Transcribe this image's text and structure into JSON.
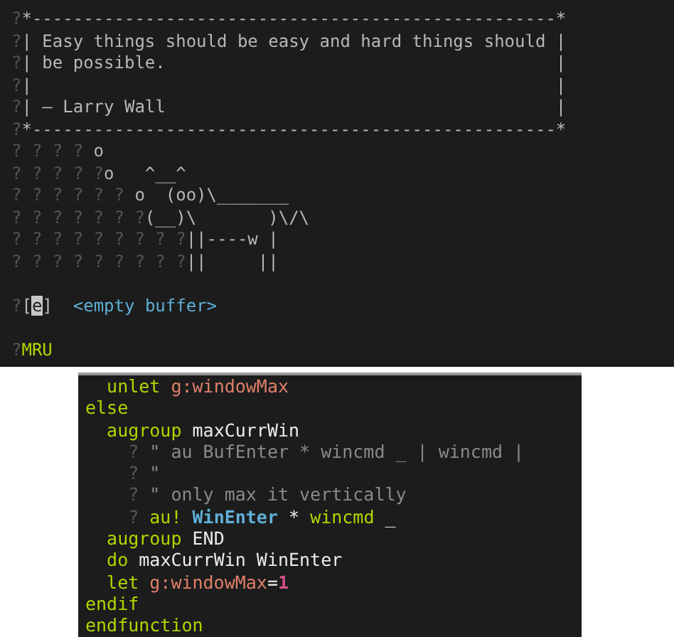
{
  "startscreen": {
    "lines": [
      {
        "kind": "text",
        "tokens": [
          {
            "kind": "gutter",
            "text": "?"
          },
          {
            "kind": "text",
            "text": "*---------------------------------------------------*"
          }
        ]
      },
      {
        "kind": "text",
        "tokens": [
          {
            "kind": "gutter",
            "text": "?"
          },
          {
            "kind": "text",
            "text": "| Easy things should be easy and hard things should |"
          }
        ]
      },
      {
        "kind": "text",
        "tokens": [
          {
            "kind": "gutter",
            "text": "?"
          },
          {
            "kind": "text",
            "text": "| be possible.                                      |"
          }
        ]
      },
      {
        "kind": "text",
        "tokens": [
          {
            "kind": "gutter",
            "text": "?"
          },
          {
            "kind": "text",
            "text": "|                                                   |"
          }
        ]
      },
      {
        "kind": "text",
        "tokens": [
          {
            "kind": "gutter",
            "text": "?"
          },
          {
            "kind": "text",
            "text": "| – Larry Wall                                      |"
          }
        ]
      },
      {
        "kind": "text",
        "tokens": [
          {
            "kind": "gutter",
            "text": "?"
          },
          {
            "kind": "text",
            "text": "*---------------------------------------------------*"
          }
        ]
      },
      {
        "kind": "text",
        "tokens": [
          {
            "kind": "gutter",
            "text": "? ? ? ? "
          },
          {
            "kind": "text",
            "text": "o"
          }
        ]
      },
      {
        "kind": "text",
        "tokens": [
          {
            "kind": "gutter",
            "text": "? ? ? ? ?"
          },
          {
            "kind": "text",
            "text": "o   ^__^"
          }
        ]
      },
      {
        "kind": "text",
        "tokens": [
          {
            "kind": "gutter",
            "text": "? ? ? ? ? ? "
          },
          {
            "kind": "text",
            "text": "o  (oo)\\_______"
          }
        ]
      },
      {
        "kind": "text",
        "tokens": [
          {
            "kind": "gutter",
            "text": "? ? ? ? ? ? ?"
          },
          {
            "kind": "text",
            "text": "(__)\\       )\\/\\"
          }
        ]
      },
      {
        "kind": "text",
        "tokens": [
          {
            "kind": "gutter",
            "text": "? ? ? ? ? ? ? ? ?"
          },
          {
            "kind": "text",
            "text": "||----w |"
          }
        ]
      },
      {
        "kind": "text",
        "tokens": [
          {
            "kind": "gutter",
            "text": "? ? ? ? ? ? ? ? ?"
          },
          {
            "kind": "text",
            "text": "||     ||"
          }
        ]
      },
      {
        "kind": "blank"
      },
      {
        "kind": "text",
        "tokens": [
          {
            "kind": "gutter",
            "text": "?"
          },
          {
            "kind": "text",
            "text": "["
          },
          {
            "kind": "cursor",
            "text": "e"
          },
          {
            "kind": "text",
            "text": "]"
          },
          {
            "kind": "special",
            "text": "  <empty buffer>"
          }
        ]
      },
      {
        "kind": "blank"
      },
      {
        "kind": "text",
        "tokens": [
          {
            "kind": "gutter",
            "text": "?"
          },
          {
            "kind": "header",
            "text": "MRU"
          }
        ]
      }
    ]
  },
  "editor": {
    "lines": [
      [
        {
          "kind": "keyword",
          "text": "  unlet "
        },
        {
          "kind": "variable",
          "text": "g:windowMax"
        }
      ],
      [
        {
          "kind": "keyword",
          "text": "else"
        }
      ],
      [
        {
          "kind": "keyword",
          "text": "  augroup "
        },
        {
          "kind": "ident",
          "text": "maxCurrWin"
        }
      ],
      [
        {
          "kind": "gutter",
          "text": "    ? "
        },
        {
          "kind": "comment",
          "text": "\" au BufEnter * wincmd _ | wincmd |"
        }
      ],
      [
        {
          "kind": "gutter",
          "text": "    ? "
        },
        {
          "kind": "comment",
          "text": "\""
        }
      ],
      [
        {
          "kind": "gutter",
          "text": "    ? "
        },
        {
          "kind": "comment",
          "text": "\" only max it vertically"
        }
      ],
      [
        {
          "kind": "gutter",
          "text": "    ? "
        },
        {
          "kind": "keyword",
          "text": "au! "
        },
        {
          "kind": "function",
          "text": "WinEnter"
        },
        {
          "kind": "ident",
          "text": " * "
        },
        {
          "kind": "keyword",
          "text": "wincmd"
        },
        {
          "kind": "ident",
          "text": " _"
        }
      ],
      [
        {
          "kind": "keyword",
          "text": "  augroup "
        },
        {
          "kind": "ident",
          "text": "END"
        }
      ],
      [
        {
          "kind": "keyword",
          "text": "  do "
        },
        {
          "kind": "ident",
          "text": "maxCurrWin WinEnter"
        }
      ],
      [
        {
          "kind": "keyword",
          "text": "  let "
        },
        {
          "kind": "variable",
          "text": "g:windowMax"
        },
        {
          "kind": "ident",
          "text": "="
        },
        {
          "kind": "number",
          "text": "1"
        }
      ],
      [
        {
          "kind": "keyword",
          "text": "endif"
        }
      ],
      [
        {
          "kind": "keyword",
          "text": "endfunction"
        }
      ]
    ]
  }
}
